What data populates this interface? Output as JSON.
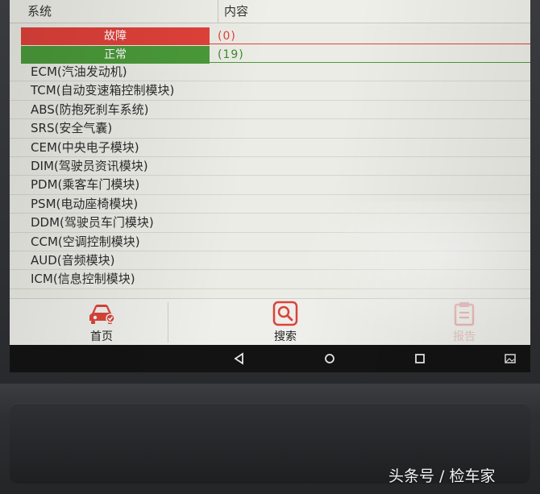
{
  "header": {
    "col1": "系统",
    "col2": "内容"
  },
  "status": {
    "fault_label": "故障",
    "fault_count": "(0)",
    "normal_label": "正常",
    "normal_count": "(19)"
  },
  "modules": [
    "ECM(汽油发动机)",
    "TCM(自动变速箱控制模块)",
    "ABS(防抱死刹车系统)",
    "SRS(安全气囊)",
    "CEM(中央电子模块)",
    "DIM(驾驶员资讯模块)",
    "PDM(乘客车门模块)",
    "PSM(电动座椅模块)",
    "DDM(驾驶员车门模块)",
    "CCM(空调控制模块)",
    "AUD(音频模块)",
    "ICM(信息控制模块)"
  ],
  "bottom_nav": {
    "home": "首页",
    "search": "搜索",
    "report": "报告"
  },
  "watermark": "头条号 / 检车家",
  "colors": {
    "fault": "#e0413a",
    "normal": "#4b9a3a",
    "accent": "#d9443a"
  },
  "icons": {
    "home": "car-icon",
    "search": "search-icon",
    "report": "report-icon",
    "back": "back-triangle-icon",
    "home_sys": "home-circle-icon",
    "recents": "recents-square-icon",
    "screenshot": "screenshot-icon"
  }
}
